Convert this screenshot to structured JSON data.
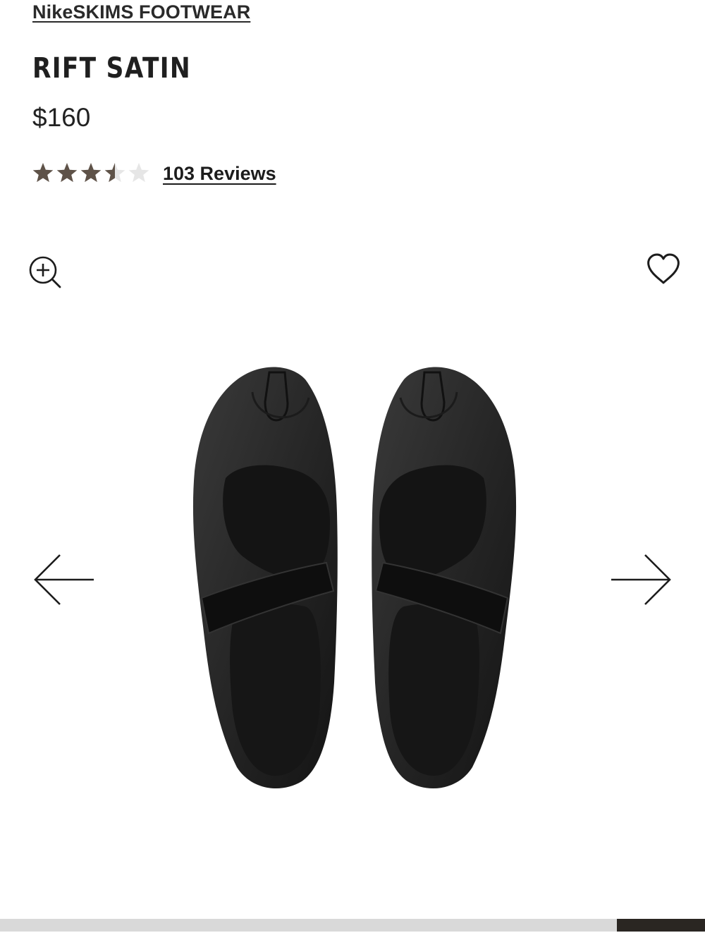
{
  "breadcrumb": {
    "label": "NikeSKIMS FOOTWEAR"
  },
  "product": {
    "title": "RIFT SATIN",
    "price": "$160",
    "rating": 3.5,
    "rating_max": 5,
    "reviews_label": "103 Reviews"
  },
  "icons": {
    "zoom": "zoom-in-icon",
    "wishlist": "heart-icon",
    "previous": "arrow-left-icon",
    "next": "arrow-right-icon"
  },
  "gallery": {
    "image_alt": "Pair of black Rift Satin split-toe shoes, top view",
    "position": 8,
    "total": 8
  },
  "colors": {
    "star_filled": "#5e5248",
    "star_empty": "#e6e6e6",
    "text": "#1e1e1e",
    "progress_track": "#d9d9d9",
    "progress_thumb": "#2a2622"
  }
}
